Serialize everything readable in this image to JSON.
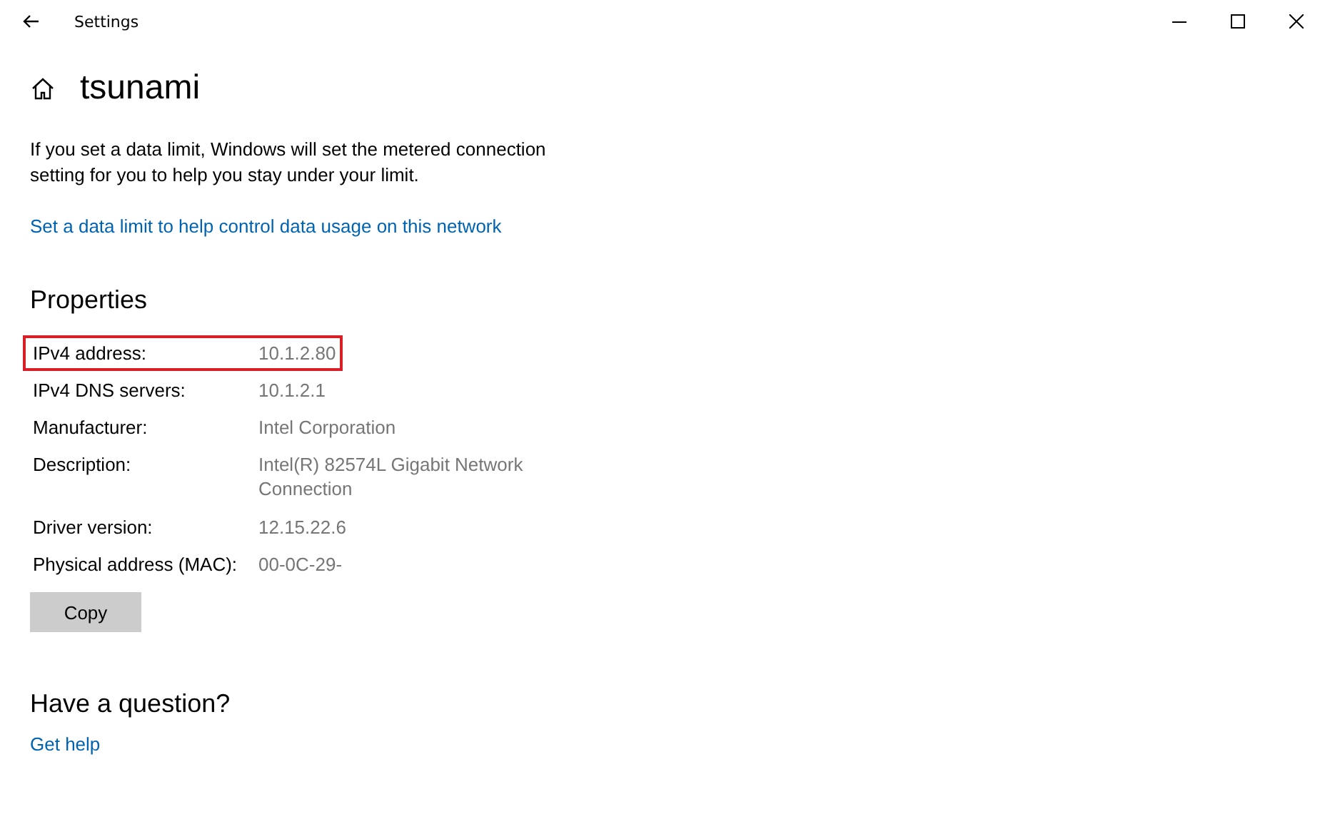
{
  "window": {
    "title": "Settings"
  },
  "page": {
    "title": "tsunami"
  },
  "intro": "If you set a data limit, Windows will set the metered connection setting for you to help you stay under your limit.",
  "data_limit_link": "Set a data limit to help control data usage on this network",
  "properties": {
    "heading": "Properties",
    "rows": [
      {
        "label": "IPv4 address:",
        "value": "10.1.2.80",
        "highlighted": true
      },
      {
        "label": "IPv4 DNS servers:",
        "value": "10.1.2.1",
        "highlighted": false
      },
      {
        "label": "Manufacturer:",
        "value": "Intel Corporation",
        "highlighted": false
      },
      {
        "label": "Description:",
        "value": "Intel(R) 82574L Gigabit Network Connection",
        "highlighted": false
      },
      {
        "label": "Driver version:",
        "value": "12.15.22.6",
        "highlighted": false
      },
      {
        "label": "Physical address (MAC):",
        "value": "00-0C-29-",
        "highlighted": false
      }
    ],
    "copy_button": "Copy"
  },
  "help": {
    "heading": "Have a question?",
    "link": "Get help"
  }
}
